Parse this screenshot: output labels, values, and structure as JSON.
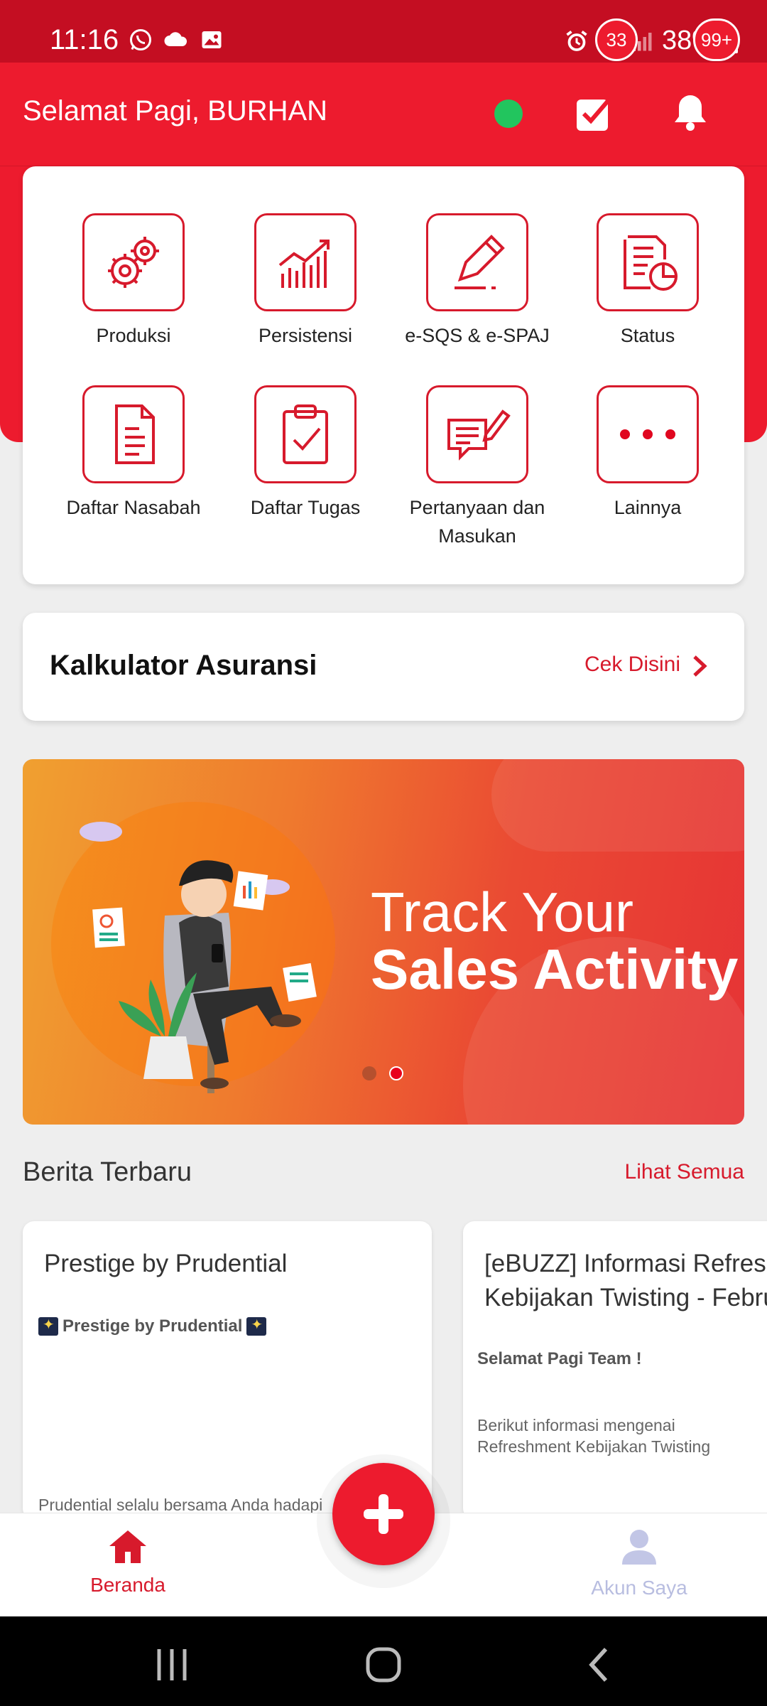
{
  "status_bar": {
    "time": "11:16",
    "battery": "38%",
    "left_icons": [
      "whatsapp-icon",
      "cloud-icon",
      "gallery-icon"
    ],
    "right_icons": [
      "alarm-icon",
      "wifi-icon",
      "signal-icon",
      "battery-icon"
    ]
  },
  "header": {
    "greeting": "Selamat Pagi, BURHAN",
    "online_status_color": "#22c55e",
    "tasks_badge": "33",
    "notifications_badge": "99+"
  },
  "menu": {
    "items": [
      {
        "label": "Produksi",
        "icon": "gears-icon"
      },
      {
        "label": "Persistensi",
        "icon": "growth-chart-icon"
      },
      {
        "label": "e-SQS & e-SPAJ",
        "icon": "pencil-icon"
      },
      {
        "label": "Status",
        "icon": "report-pie-icon"
      },
      {
        "label": "Daftar Nasabah",
        "icon": "document-icon"
      },
      {
        "label": "Daftar Tugas",
        "icon": "clipboard-check-icon"
      },
      {
        "label": "Pertanyaan dan Masukan",
        "icon": "feedback-icon"
      },
      {
        "label": "Lainnya",
        "icon": "more-dots-icon"
      }
    ]
  },
  "calculator": {
    "title": "Kalkulator Asuransi",
    "link": "Cek Disini"
  },
  "banner": {
    "line1": "Track Your",
    "line2": "Sales Activity",
    "slide_count": 2,
    "active_slide": 2
  },
  "news": {
    "title": "Berita Terbaru",
    "see_all": "Lihat Semua",
    "cards": [
      {
        "title": "Prestige by Prudential",
        "subtitle": "Prestige by Prudential",
        "body": "Prudential selalu bersama Anda hadapi"
      },
      {
        "title": "[eBUZZ] Informasi Refres\nKebijakan Twisting - Febru",
        "subtitle": "Selamat Pagi Team !",
        "body": "Berikut informasi mengenai\nRefreshment Kebijakan Twisting"
      }
    ]
  },
  "bottom_nav": {
    "home": "Beranda",
    "account": "Akun Saya"
  },
  "colors": {
    "brand_red": "#ed1b2e",
    "status_red": "#c40e22"
  }
}
